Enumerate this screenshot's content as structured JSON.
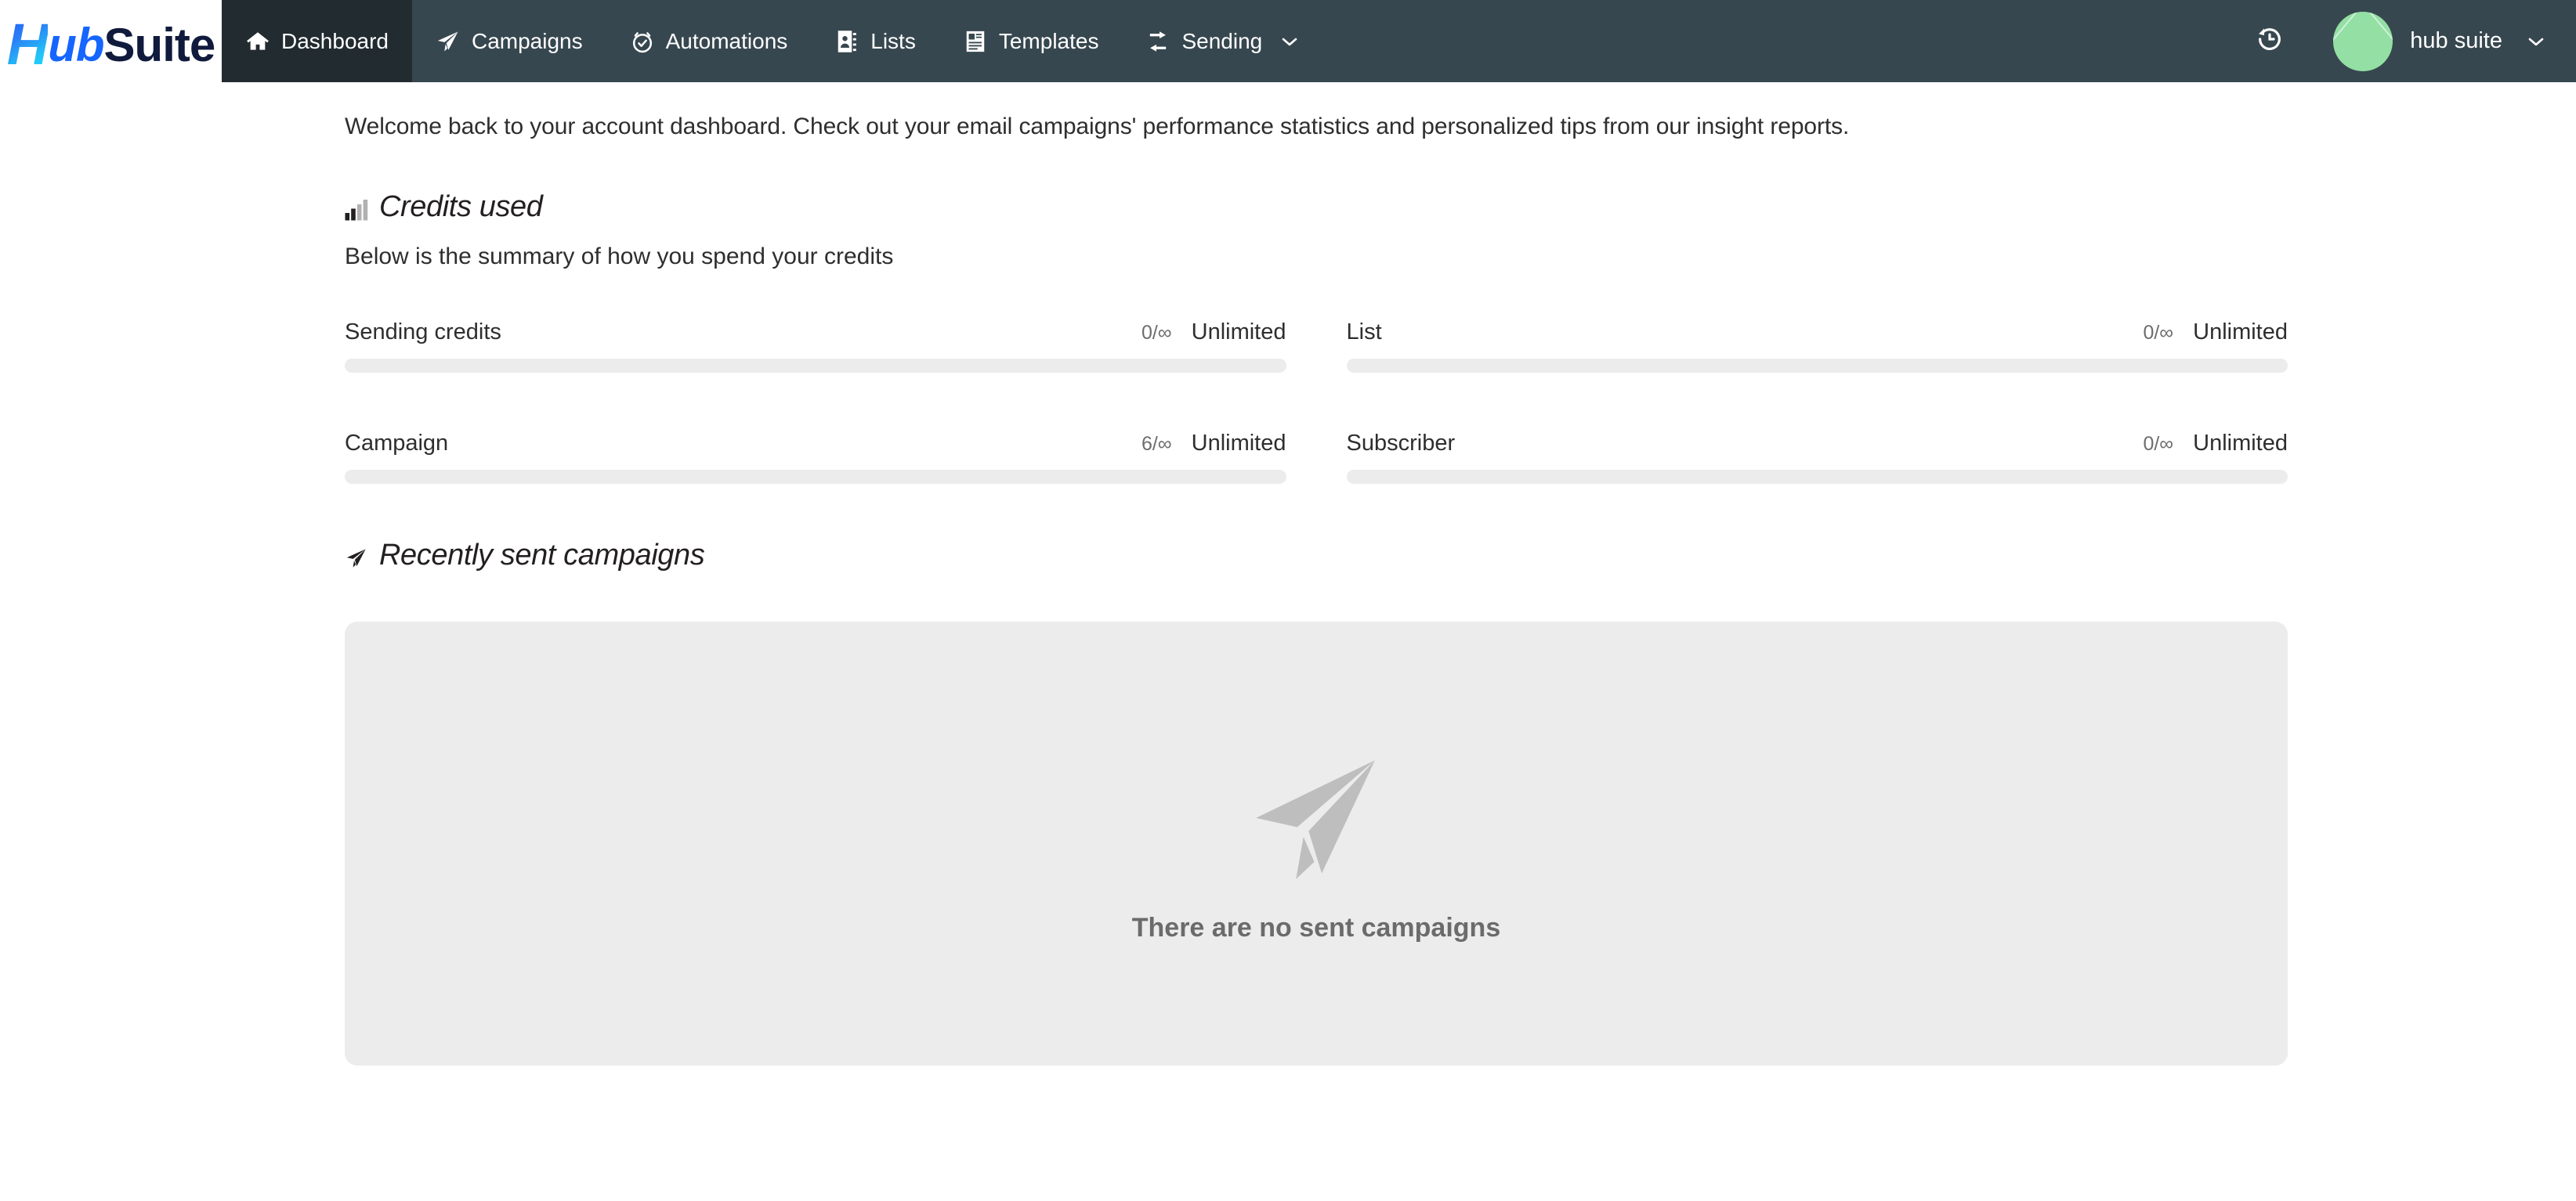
{
  "brand": {
    "logo_part1": "H",
    "logo_part2": "ub",
    "logo_part3": "Suite",
    "icon": "hubsuite-logo"
  },
  "navbar": {
    "background_color": "#37474f",
    "active_background_color": "#212b30",
    "items": [
      {
        "label": "Dashboard",
        "icon": "home-icon",
        "active": true,
        "has_caret": false
      },
      {
        "label": "Campaigns",
        "icon": "paper-plane-icon",
        "active": false,
        "has_caret": false
      },
      {
        "label": "Automations",
        "icon": "stopwatch-icon",
        "active": false,
        "has_caret": false
      },
      {
        "label": "Lists",
        "icon": "address-book-icon",
        "active": false,
        "has_caret": false
      },
      {
        "label": "Templates",
        "icon": "document-id-icon",
        "active": false,
        "has_caret": false
      },
      {
        "label": "Sending",
        "icon": "exchange-icon",
        "active": false,
        "has_caret": true
      }
    ],
    "history_icon": "history-clock-icon",
    "user": {
      "name": "hub suite",
      "avatar_icon": "broken-image-avatar",
      "avatar_color": "#93dfa4",
      "caret_icon": "chevron-down-icon"
    }
  },
  "main": {
    "welcome": "Welcome back to your account dashboard. Check out your email campaigns' performance statistics and personalized tips from our insight reports.",
    "credits_section": {
      "icon": "bar-chart-icon",
      "title": "Credits used",
      "subtitle": "Below is the summary of how you spend your credits",
      "items": [
        {
          "label": "Sending credits",
          "ratio": "0/∞",
          "cap": "Unlimited",
          "percent": 0
        },
        {
          "label": "List",
          "ratio": "0/∞",
          "cap": "Unlimited",
          "percent": 0
        },
        {
          "label": "Campaign",
          "ratio": "6/∞",
          "cap": "Unlimited",
          "percent": 0
        },
        {
          "label": "Subscriber",
          "ratio": "0/∞",
          "cap": "Unlimited",
          "percent": 0
        }
      ]
    },
    "recent_section": {
      "icon": "paper-plane-icon",
      "title": "Recently sent campaigns",
      "empty_icon": "paper-plane-empty-icon",
      "empty_text": "There are no sent campaigns"
    }
  },
  "colors": {
    "nav_bg": "#37474f",
    "nav_active": "#212b30",
    "accent": "#1565ff",
    "track": "#ececec",
    "panel": "#ececec",
    "muted_text": "#6b6b6b"
  }
}
